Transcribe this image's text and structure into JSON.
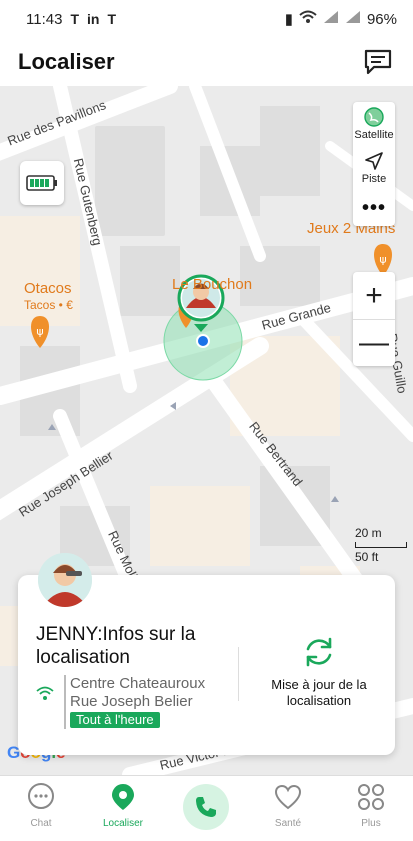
{
  "status": {
    "time": "11:43",
    "battery": "96%",
    "icons": [
      "T",
      "in",
      "T"
    ]
  },
  "header": {
    "title": "Localiser"
  },
  "map": {
    "streets": [
      "Rue des Pavillons",
      "Rue Gutenberg",
      "Rue Grande",
      "Rue Joseph Bellier",
      "Rue Bertrand",
      "Rue Molière",
      "Rue Victor H",
      "Rue Guillo"
    ],
    "pois": [
      {
        "name": "Otacos",
        "sub": "Tacos • €"
      },
      {
        "name": "Le Bouchon",
        "sub": ""
      },
      {
        "name": "Jeux 2 Mains",
        "sub": ""
      }
    ],
    "controls": {
      "satellite": "Satellite",
      "track": "Piste",
      "more": "•••",
      "zoom_in": "+",
      "zoom_out": "—"
    },
    "scale": {
      "metric": "20 m",
      "imperial": "50 ft"
    },
    "attribution": "Google"
  },
  "card": {
    "title": "JENNY:Infos sur la localisation",
    "location_line1": "Centre Chateauroux",
    "location_line2": "Rue Joseph Belier",
    "badge": "Tout à l'heure",
    "update_label": "Mise à jour de la localisation"
  },
  "nav": {
    "chat": "Chat",
    "locate": "Localiser",
    "health": "Santé",
    "more": "Plus"
  },
  "colors": {
    "accent": "#1aa85b",
    "poi": "#e07a1c"
  }
}
